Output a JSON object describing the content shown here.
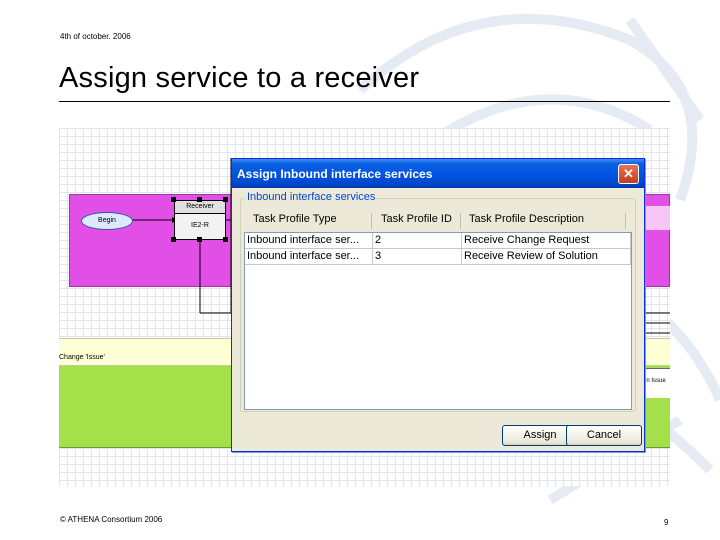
{
  "slide": {
    "date": "4th of october. 2006",
    "title": "Assign service to a receiver",
    "footer_left": "© ATHENA Consortium 2006",
    "page_number": "9"
  },
  "diagram": {
    "begin_label": "Begin",
    "receiver_header": "Receiver",
    "receiver_node": "IE2-R",
    "lane_label": "Change 'Issue'",
    "right_label": "gn Issue",
    "colors": {
      "magenta_lane": "#e14fe6",
      "yellow_lane": "#ffffd6",
      "green_lane": "#a3e04a"
    }
  },
  "dialog": {
    "title": "Assign Inbound interface services",
    "group_label": "Inbound interface services",
    "columns": [
      "Task Profile Type",
      "Task Profile ID",
      "Task Profile Description"
    ],
    "rows": [
      [
        "Inbound interface ser...",
        "2",
        "Receive Change Request"
      ],
      [
        "Inbound interface ser...",
        "3",
        "Receive Review of Solution"
      ]
    ],
    "assign_label": "Assign",
    "cancel_label": "Cancel",
    "close_icon": "close-icon",
    "colors": {
      "titlebar": "#0054e3",
      "window": "#ece9d8"
    }
  }
}
